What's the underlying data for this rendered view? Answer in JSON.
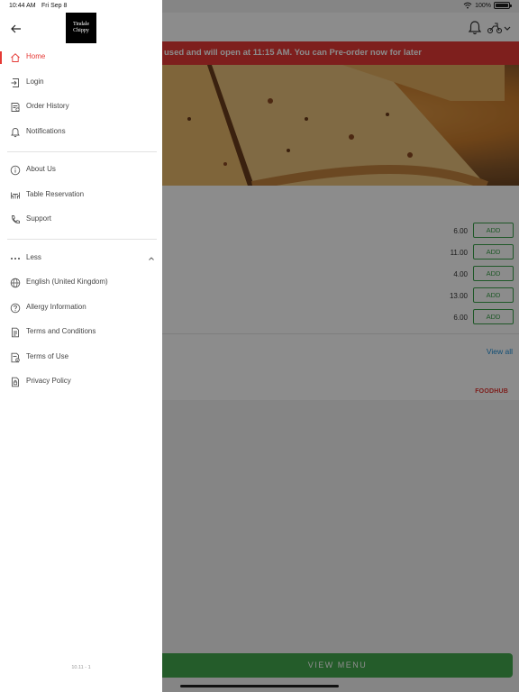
{
  "status_bar": {
    "time": "10:44 AM",
    "date": "Fri Sep 8",
    "battery": "100%",
    "battery_level": 1.0,
    "wifi_icon": "wifi-icon"
  },
  "drawer": {
    "logo_text": "Tindale Chippy",
    "back_icon": "back-arrow-icon",
    "primary_items": [
      {
        "label": "Home",
        "icon": "home-icon",
        "active": true
      },
      {
        "label": "Login",
        "icon": "login-icon"
      },
      {
        "label": "Order History",
        "icon": "order-history-icon"
      },
      {
        "label": "Notifications",
        "icon": "bell-icon"
      }
    ],
    "secondary_items": [
      {
        "label": "About Us",
        "icon": "info-icon"
      },
      {
        "label": "Table Reservation",
        "icon": "table-icon"
      },
      {
        "label": "Support",
        "icon": "phone-icon"
      }
    ],
    "more_toggle": {
      "label": "Less",
      "icon": "more-dots-icon",
      "chevron": "chevron-up-icon"
    },
    "extra_items": [
      {
        "label": "English (United Kingdom)",
        "icon": "globe-icon"
      },
      {
        "label": "Allergy Information",
        "icon": "question-icon"
      },
      {
        "label": "Terms and Conditions",
        "icon": "document-icon"
      },
      {
        "label": "Terms of Use",
        "icon": "document-check-icon"
      },
      {
        "label": "Privacy Policy",
        "icon": "privacy-icon"
      }
    ],
    "version": "10.11 - 1"
  },
  "page": {
    "closed_banner": "used and will open at 11:15 AM. You can Pre-order now for later",
    "menu_items": [
      {
        "price": "6.00",
        "button": "ADD"
      },
      {
        "price": "11.00",
        "button": "ADD"
      },
      {
        "price": "4.00",
        "button": "ADD"
      },
      {
        "price": "13.00",
        "button": "ADD"
      },
      {
        "price": "6.00",
        "button": "ADD"
      }
    ],
    "view_all": "View all",
    "brand": "FOODHUB",
    "view_menu_button": "VIEW MENU",
    "header_icons": [
      "bell-icon",
      "delivery-scooter-icon",
      "chevron-down-icon"
    ]
  },
  "colors": {
    "accent_red": "#e53935",
    "add_green": "#3aa14a",
    "view_menu_green": "#42a84d",
    "link_blue": "#1f8fd6"
  }
}
